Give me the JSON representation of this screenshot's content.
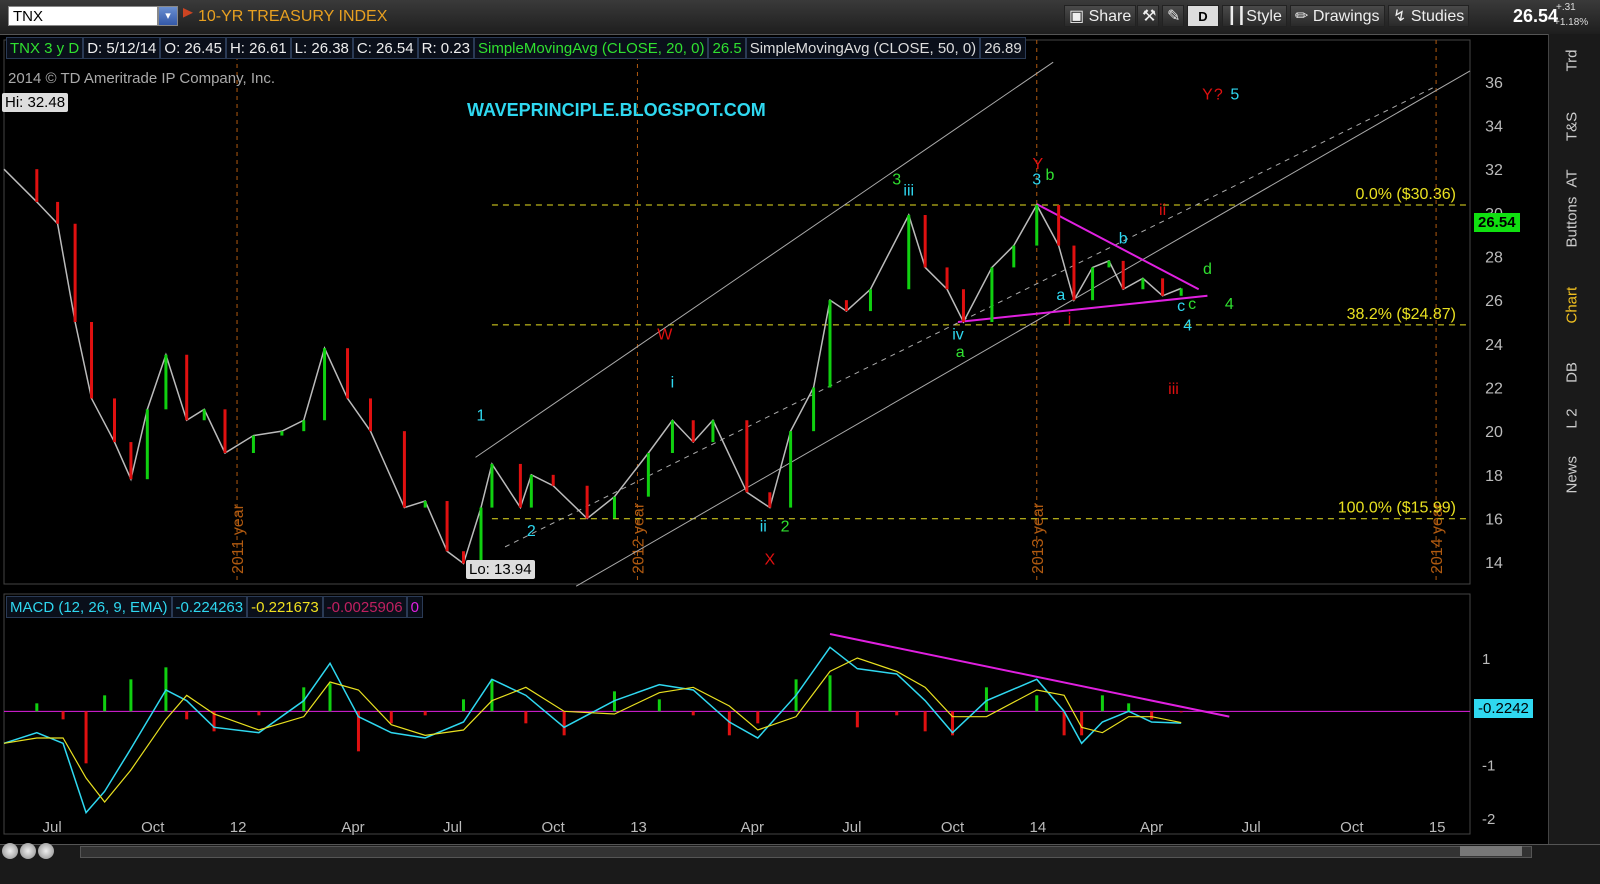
{
  "toolbar": {
    "symbol": "TNX",
    "description": "10-YR TREASURY INDEX",
    "share_label": "Share",
    "d_label": "D",
    "style_label": "Style",
    "drawings_label": "Drawings",
    "studies_label": "Studies",
    "last_price": "26.54",
    "change_abs": "+.31",
    "change_pct": "+1.18%"
  },
  "right_tabs": [
    "Trd",
    "T&S",
    "AT",
    "Buttons",
    "Chart",
    "DB",
    "L 2",
    "News"
  ],
  "info_bar": {
    "symbol_period": "TNX 3 y D",
    "date": "D: 5/12/14",
    "open": "O: 26.45",
    "high": "H: 26.61",
    "low": "L: 26.38",
    "close": "C: 26.54",
    "range": "R: 0.23",
    "sma20_label": "SimpleMovingAvg (CLOSE, 20, 0)",
    "sma20_value": "26.5",
    "sma50_label": "SimpleMovingAvg (CLOSE, 50, 0)",
    "sma50_value": "26.89"
  },
  "copyright": "2014 © TD Ameritrade IP Company, Inc.",
  "hi_label": "Hi: 32.48",
  "lo_label": "Lo: 13.94",
  "blog": "WAVEPRINCIPLE.BLOGSPOT.COM",
  "last_price_tag": "26.54",
  "macd_bar": {
    "label": "MACD (12, 26, 9, EMA)",
    "value": "-0.224263",
    "avg": "-0.221673",
    "diff": "-0.0025906",
    "zero": "0"
  },
  "macd_value_tag": "-0.2242",
  "colors": {
    "up": "#10d010",
    "down": "#e01010",
    "sma20": "#10c010",
    "sma50": "#bbbbbb",
    "annotation_cyan": "#2fd8f0",
    "annotation_green": "#30e030",
    "annotation_red": "#e01010",
    "fib_yellow": "#e8e020",
    "trendline_magenta": "#e020e0",
    "year_marker": "#b05a10"
  },
  "chart_data": {
    "type": "line",
    "title": "TNX 3 y D",
    "price_axis_ticks": [
      14,
      16,
      18,
      20,
      22,
      24,
      26,
      28,
      30,
      32,
      34,
      36
    ],
    "time_axis_labels": [
      "Jul",
      "Oct",
      "12",
      "Apr",
      "Jul",
      "Oct",
      "13",
      "Apr",
      "Jul",
      "Oct",
      "14",
      "Apr",
      "Jul",
      "Oct",
      "15"
    ],
    "year_markers": [
      "2011 year",
      "2012 year",
      "2013 year",
      "2014 year"
    ],
    "ylim": [
      13,
      37
    ],
    "fib_levels": [
      {
        "pct": "0.0%",
        "price": "($30.36)",
        "value": 30.36
      },
      {
        "pct": "38.2%",
        "price": "($24.87)",
        "value": 24.87
      },
      {
        "pct": "100.0%",
        "price": "($15.99)",
        "value": 15.99
      }
    ],
    "price_path": [
      [
        "2011-06-01",
        32.0
      ],
      [
        "2011-07-01",
        30.5
      ],
      [
        "2011-07-20",
        29.5
      ],
      [
        "2011-08-05",
        25.0
      ],
      [
        "2011-08-20",
        21.5
      ],
      [
        "2011-09-10",
        19.5
      ],
      [
        "2011-09-25",
        17.8
      ],
      [
        "2011-10-10",
        21.0
      ],
      [
        "2011-10-27",
        23.5
      ],
      [
        "2011-11-15",
        20.5
      ],
      [
        "2011-12-01",
        21.0
      ],
      [
        "2011-12-20",
        19.0
      ],
      [
        "2012-01-15",
        19.8
      ],
      [
        "2012-02-10",
        20.0
      ],
      [
        "2012-03-01",
        20.5
      ],
      [
        "2012-03-20",
        23.8
      ],
      [
        "2012-04-10",
        21.5
      ],
      [
        "2012-05-01",
        20.0
      ],
      [
        "2012-06-01",
        16.5
      ],
      [
        "2012-06-20",
        16.8
      ],
      [
        "2012-07-10",
        14.5
      ],
      [
        "2012-07-25",
        13.94
      ],
      [
        "2012-08-10",
        16.5
      ],
      [
        "2012-08-20",
        18.5
      ],
      [
        "2012-09-15",
        16.5
      ],
      [
        "2012-09-25",
        18.0
      ],
      [
        "2012-10-15",
        17.5
      ],
      [
        "2012-11-15",
        16.0
      ],
      [
        "2012-12-10",
        17.0
      ],
      [
        "2013-01-10",
        19.0
      ],
      [
        "2013-02-01",
        20.5
      ],
      [
        "2013-02-20",
        19.5
      ],
      [
        "2013-03-10",
        20.5
      ],
      [
        "2013-04-10",
        17.2
      ],
      [
        "2013-05-01",
        16.5
      ],
      [
        "2013-05-20",
        20.0
      ],
      [
        "2013-06-10",
        22.0
      ],
      [
        "2013-06-25",
        26.0
      ],
      [
        "2013-07-10",
        25.5
      ],
      [
        "2013-08-01",
        26.5
      ],
      [
        "2013-09-05",
        29.9
      ],
      [
        "2013-09-20",
        27.5
      ],
      [
        "2013-10-10",
        26.5
      ],
      [
        "2013-10-25",
        25.0
      ],
      [
        "2013-11-20",
        27.5
      ],
      [
        "2013-12-10",
        28.5
      ],
      [
        "2013-12-31",
        30.36
      ],
      [
        "2014-01-20",
        28.5
      ],
      [
        "2014-02-03",
        26.0
      ],
      [
        "2014-02-20",
        27.5
      ],
      [
        "2014-03-07",
        27.8
      ],
      [
        "2014-03-20",
        26.5
      ],
      [
        "2014-04-07",
        27.0
      ],
      [
        "2014-04-25",
        26.2
      ],
      [
        "2014-05-12",
        26.54
      ]
    ],
    "wave_labels": [
      {
        "text": "1",
        "color": "cyan"
      },
      {
        "text": "2",
        "color": "cyan"
      },
      {
        "text": "3",
        "color": "green"
      },
      {
        "text": "iii",
        "color": "cyan"
      },
      {
        "text": "i",
        "color": "cyan"
      },
      {
        "text": "ii",
        "color": "cyan"
      },
      {
        "text": "2",
        "color": "green"
      },
      {
        "text": "W",
        "color": "red"
      },
      {
        "text": "X",
        "color": "red"
      },
      {
        "text": "Y",
        "color": "red"
      },
      {
        "text": "3",
        "color": "cyan"
      },
      {
        "text": "b",
        "color": "green"
      },
      {
        "text": "iv",
        "color": "cyan"
      },
      {
        "text": "a",
        "color": "green"
      },
      {
        "text": "a",
        "color": "cyan"
      },
      {
        "text": "b",
        "color": "cyan"
      },
      {
        "text": "i",
        "color": "red"
      },
      {
        "text": "ii",
        "color": "red"
      },
      {
        "text": "iii",
        "color": "red"
      },
      {
        "text": "c",
        "color": "cyan"
      },
      {
        "text": "c",
        "color": "green"
      },
      {
        "text": "4",
        "color": "cyan"
      },
      {
        "text": "4",
        "color": "green"
      },
      {
        "text": "d",
        "color": "green"
      },
      {
        "text": "Y",
        "color": "red"
      },
      {
        "text": "?",
        "color": "red"
      },
      {
        "text": "5",
        "color": "cyan"
      }
    ],
    "macd": {
      "ticks": [
        -2,
        -1,
        0,
        1
      ],
      "ylim": [
        -2.3,
        1.6
      ],
      "value": -0.224263,
      "avg": -0.221673,
      "diff": -0.0025906,
      "path": [
        [
          "2011-06-01",
          -0.6
        ],
        [
          "2011-07-01",
          -0.4
        ],
        [
          "2011-07-25",
          -0.6
        ],
        [
          "2011-08-15",
          -1.9
        ],
        [
          "2011-09-01",
          -1.5
        ],
        [
          "2011-09-25",
          -0.7
        ],
        [
          "2011-10-27",
          0.4
        ],
        [
          "2011-11-15",
          0.2
        ],
        [
          "2011-12-10",
          -0.3
        ],
        [
          "2012-01-20",
          -0.4
        ],
        [
          "2012-03-01",
          0.2
        ],
        [
          "2012-03-25",
          0.9
        ],
        [
          "2012-04-20",
          -0.1
        ],
        [
          "2012-05-20",
          -0.4
        ],
        [
          "2012-06-20",
          -0.5
        ],
        [
          "2012-07-25",
          -0.2
        ],
        [
          "2012-08-20",
          0.6
        ],
        [
          "2012-09-20",
          0.3
        ],
        [
          "2012-10-25",
          -0.3
        ],
        [
          "2012-12-10",
          0.2
        ],
        [
          "2013-01-20",
          0.5
        ],
        [
          "2013-02-20",
          0.4
        ],
        [
          "2013-03-25",
          -0.2
        ],
        [
          "2013-04-20",
          -0.5
        ],
        [
          "2013-05-25",
          0.3
        ],
        [
          "2013-06-25",
          1.2
        ],
        [
          "2013-07-20",
          0.8
        ],
        [
          "2013-08-25",
          0.7
        ],
        [
          "2013-09-20",
          0.2
        ],
        [
          "2013-10-15",
          -0.4
        ],
        [
          "2013-11-15",
          0.2
        ],
        [
          "2013-12-31",
          0.6
        ],
        [
          "2014-01-25",
          0.0
        ],
        [
          "2014-02-10",
          -0.6
        ],
        [
          "2014-03-01",
          -0.2
        ],
        [
          "2014-03-25",
          0.0
        ],
        [
          "2014-04-15",
          -0.2
        ],
        [
          "2014-05-12",
          -0.22
        ]
      ]
    }
  }
}
